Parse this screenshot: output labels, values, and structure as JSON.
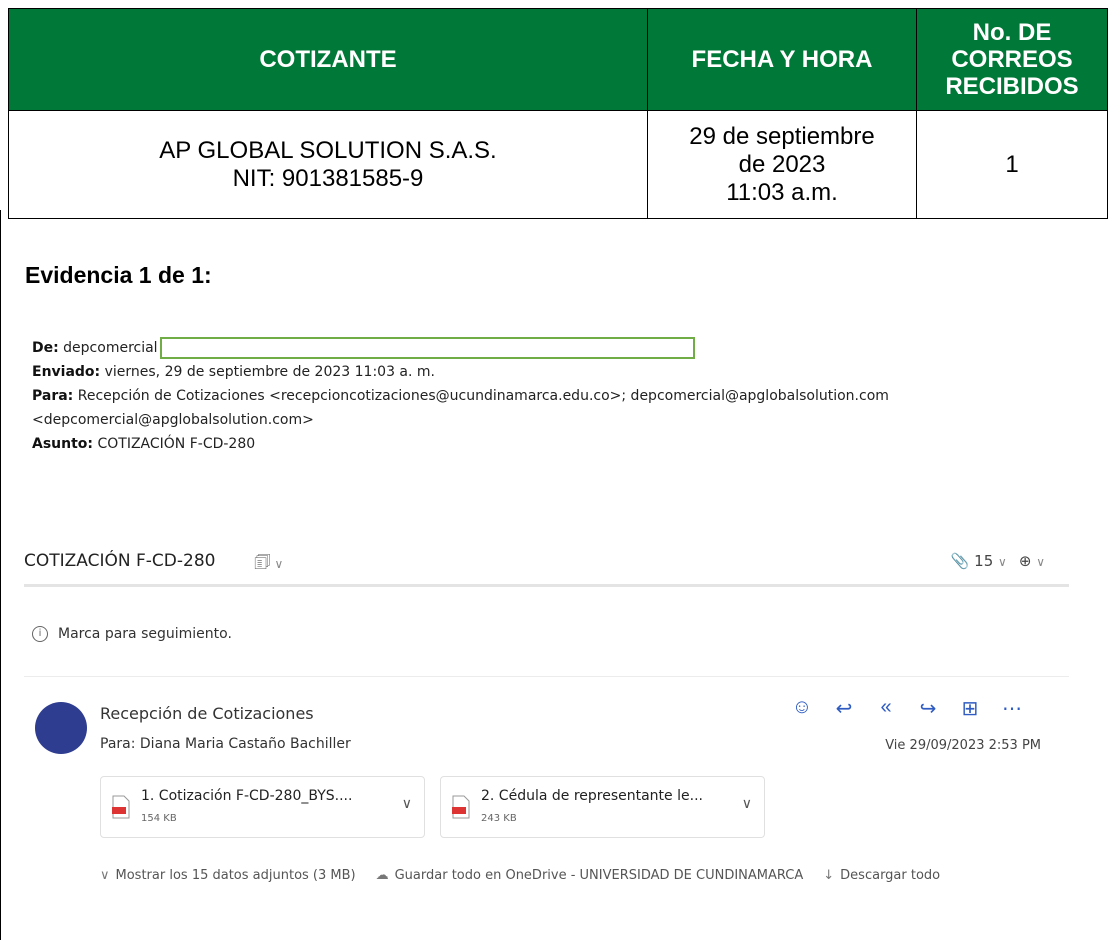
{
  "table": {
    "headers": [
      "COTIZANTE",
      "FECHA Y HORA",
      "No. DE CORREOS RECIBIDOS"
    ],
    "cotizante": [
      "AP GLOBAL SOLUTION S.A.S.",
      "NIT: 901381585-9"
    ],
    "fecha_hora": [
      "29 de septiembre",
      "de 2023",
      "11:03 a.m."
    ],
    "correos": "1"
  },
  "evidence_title": "Evidencia 1 de 1:",
  "email_header": {
    "from_label": "De:",
    "from_value": "depcomercial",
    "sent_label": "Enviado:",
    "sent_value": "viernes, 29 de septiembre de 2023 11:03 a. m.",
    "to_label": "Para:",
    "to_value": "Recepción de Cotizaciones <recepcioncotizaciones@ucundinamarca.edu.co>; depcomercial@apglobalsolution.com",
    "to_value_cont": "<depcomercial@apglobalsolution.com>",
    "subject_label": "Asunto:",
    "subject_value": "COTIZACIÓN F-CD-280"
  },
  "viewer": {
    "subject": "COTIZACIÓN F-CD-280",
    "attachments_count": "15",
    "follow_up": "Marca para seguimiento.",
    "sender": "Recepción de Cotizaciones",
    "recipient": "Para:  Diana Maria Castaño Bachiller",
    "date": "Vie 29/09/2023 2:53 PM",
    "attachments": [
      {
        "name": "1. Cotización F-CD-280_BYS....",
        "size": "154 KB"
      },
      {
        "name": "2. Cédula de representante le...",
        "size": "243 KB"
      }
    ],
    "show_all": "Mostrar los 15 datos adjuntos (3 MB)",
    "save_onedrive": "Guardar todo en OneDrive - UNIVERSIDAD DE CUNDINAMARCA",
    "download_all": "Descargar todo"
  },
  "icons": [
    "paperclip-icon",
    "zoom-icon",
    "smiley-icon",
    "reply-icon",
    "reply-all-icon",
    "forward-icon",
    "apps-icon",
    "more-icon",
    "pdf-icon",
    "cloud-icon",
    "download-icon"
  ],
  "colors": {
    "header_green": "#007837",
    "avatar": "#2e3d8f",
    "action_blue": "#2f5cc2",
    "redaction_border": "#70ad47"
  }
}
